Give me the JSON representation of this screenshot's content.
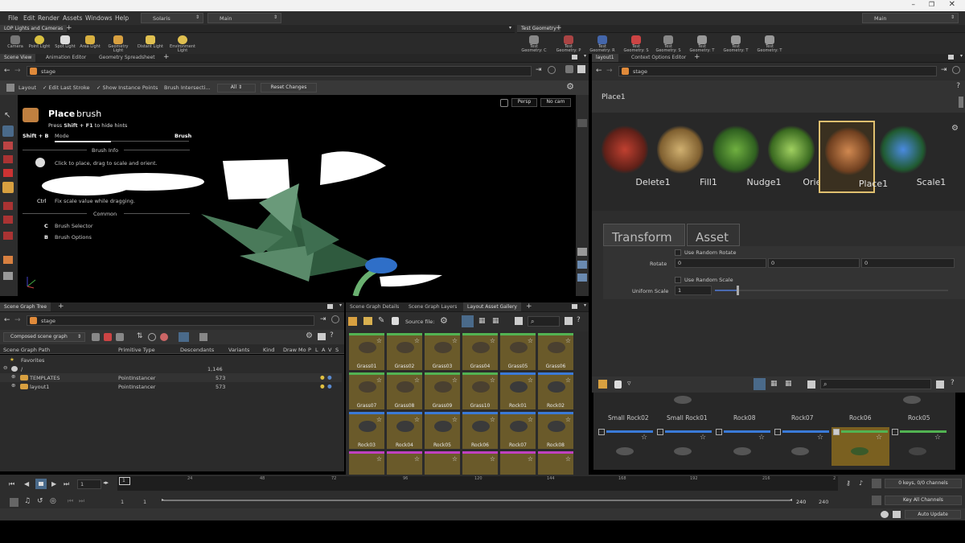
{
  "menu": {
    "items": [
      "File",
      "Edit",
      "Render",
      "Assets",
      "Windows",
      "Help"
    ],
    "desktop": "Solaris",
    "context": "Main",
    "right_context": "Main"
  },
  "shelf_left": {
    "tab": "LOP Lights and Cameras",
    "tools": [
      "Camera",
      "Point Light",
      "Spot Light",
      "Area Light",
      "Geometry Light",
      "Distant Light",
      "Environment Light"
    ]
  },
  "shelf_right": {
    "tab": "Test Geometry",
    "tools": [
      "Test Geometry: C",
      "Test Geometry: P",
      "Test Geometry: R",
      "Test Geometry: S",
      "Test Geometry: S",
      "Test Geometry: T",
      "Test Geometry: T",
      "Test Geometry: T"
    ]
  },
  "viewer": {
    "tabs": [
      "Scene View",
      "Animation Editor",
      "Geometry Spreadsheet"
    ],
    "path": "stage",
    "toolbar": {
      "layout": "Layout",
      "edit_last": "Edit Last Stroke",
      "show_instance": "Show Instance Points",
      "brush_intersect": "Brush Intersecti...",
      "all": "All",
      "reset": "Reset Changes"
    },
    "persp": "Persp",
    "cam": "No cam",
    "hud": {
      "title": "Place",
      "title2": "brush",
      "hint_pre": "Press",
      "hint_key": "Shift + F1",
      "hint_post": "to hide hints",
      "shift_b": "Shift + B",
      "mode": "Mode",
      "brush": "Brush",
      "brush_info": "Brush Info",
      "click_info": "Click to place, drag to scale and orient.",
      "ctrl": "Ctrl",
      "fix_scale": "Fix scale value while dragging.",
      "common": "Common",
      "key_c": "C",
      "brush_selector": "Brush Selector",
      "key_b": "B",
      "brush_options": "Brush Options"
    }
  },
  "right_top": {
    "tabs": [
      "layout1",
      "Context Options Editor"
    ],
    "path": "stage",
    "node": "Place1",
    "tools": [
      "Delete1",
      "Fill1",
      "Nudge1",
      "Orient1",
      "Place1",
      "Scale1"
    ],
    "param_tabs": [
      "Transform",
      "Asset"
    ],
    "use_random_rotate": "Use Random Rotate",
    "rotate": "Rotate",
    "rot_vals": [
      "0",
      "0",
      "0"
    ],
    "use_random_scale": "Use Random Scale",
    "uniform_scale": "Uniform Scale",
    "uniform_val": "1"
  },
  "scene_tree": {
    "tab": "Scene Graph Tree",
    "path": "stage",
    "mode": "Composed scene graph",
    "headers": [
      "Scene Graph Path",
      "Primitive Type",
      "Descendants",
      "Variants",
      "Kind",
      "Draw Mo",
      "P",
      "L",
      "A",
      "V",
      "S"
    ],
    "rows": [
      {
        "path": "Favorites",
        "type": "",
        "desc": ""
      },
      {
        "path": "/",
        "type": "",
        "desc": "1,146"
      },
      {
        "path": "TEMPLATES",
        "type": "PointInstancer",
        "desc": "573"
      },
      {
        "path": "layout1",
        "type": "PointInstancer",
        "desc": "573"
      }
    ]
  },
  "gallery": {
    "tabs": [
      "Scene Graph Details",
      "Scene Graph Layers",
      "Layout Asset Gallery"
    ],
    "source": "Source file:",
    "items": [
      "Grass01",
      "Grass02",
      "Grass03",
      "Grass04",
      "Grass05",
      "Grass06",
      "Grass07",
      "Grass08",
      "Grass09",
      "Grass10",
      "Rock01",
      "Rock02",
      "Rock03",
      "Rock04",
      "Rock05",
      "Rock06",
      "Rock07",
      "Rock08"
    ]
  },
  "asset_strip": {
    "items": [
      "Small Rock02",
      "Small Rock01",
      "Rock08",
      "Rock07",
      "Rock06",
      "Rock05"
    ]
  },
  "timeline": {
    "frame": "1",
    "ticks": [
      "1",
      "24",
      "48",
      "72",
      "96",
      "120",
      "144",
      "168",
      "192",
      "216",
      "2"
    ],
    "start": "1",
    "start2": "1",
    "end": "240",
    "end2": "240",
    "keys": "0 keys, 0/0 channels",
    "key_all": "Key All Channels",
    "auto_update": "Auto Update"
  },
  "colors": {
    "accent": "#3a8fd8",
    "grass": "#52b352",
    "rock": "#3a7ad8",
    "gallery_bg": "#6a5a2a"
  }
}
